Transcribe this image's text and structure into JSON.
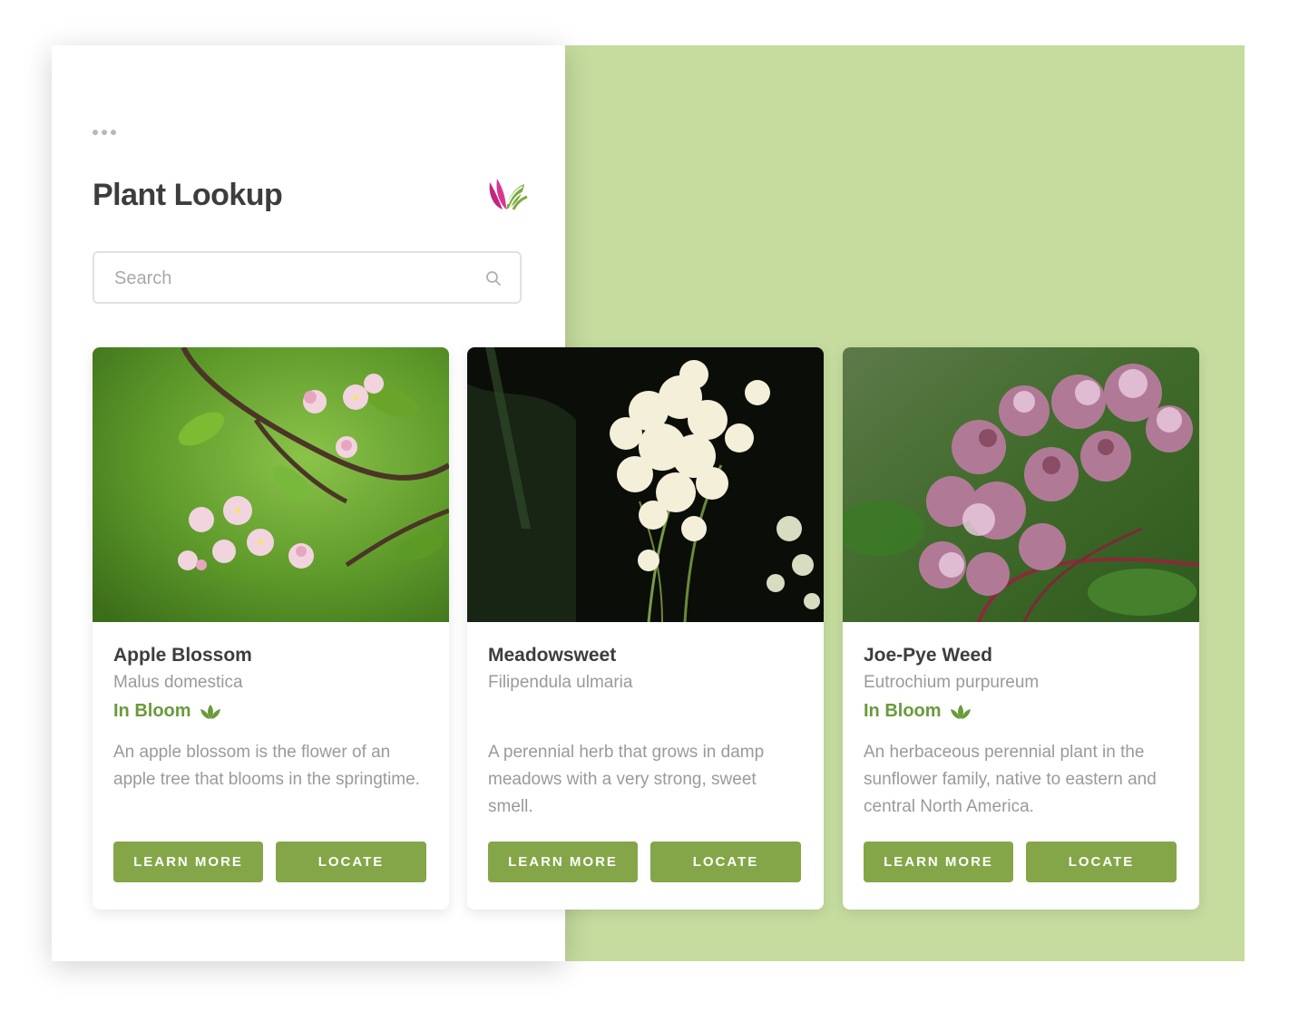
{
  "app": {
    "title": "Plant Lookup",
    "logo_icon": "lotus-leaf-logo",
    "menu_icon": "more-dots-icon"
  },
  "search": {
    "placeholder": "Search",
    "value": "",
    "icon": "search-icon"
  },
  "colors": {
    "accent": "#84a648",
    "status": "#6a9a3a",
    "background_panel": "#c5dc9e",
    "logo_magenta": "#c2267f",
    "logo_green": "#7eaa3e"
  },
  "cards": [
    {
      "name": "Apple Blossom",
      "scientific_name": "Malus domestica",
      "status": "In Bloom",
      "status_icon": "lotus-icon",
      "description": "An apple blossom is the flower of an apple tree that blooms in the springtime.",
      "learn_more_label": "LEARN MORE",
      "locate_label": "LOCATE",
      "image": "apple-blossom-photo"
    },
    {
      "name": "Meadowsweet",
      "scientific_name": "Filipendula ulmaria",
      "status": "",
      "description": "A perennial herb that grows in damp meadows with a very strong, sweet smell.",
      "learn_more_label": "LEARN MORE",
      "locate_label": "LOCATE",
      "image": "meadowsweet-photo"
    },
    {
      "name": "Joe-Pye Weed",
      "scientific_name": "Eutrochium purpureum",
      "status": "In Bloom",
      "status_icon": "lotus-icon",
      "description": "An herbaceous perennial plant in the sunflower family, native to eastern and central North America.",
      "learn_more_label": "LEARN MORE",
      "locate_label": "LOCATE",
      "image": "joe-pye-weed-photo"
    }
  ]
}
